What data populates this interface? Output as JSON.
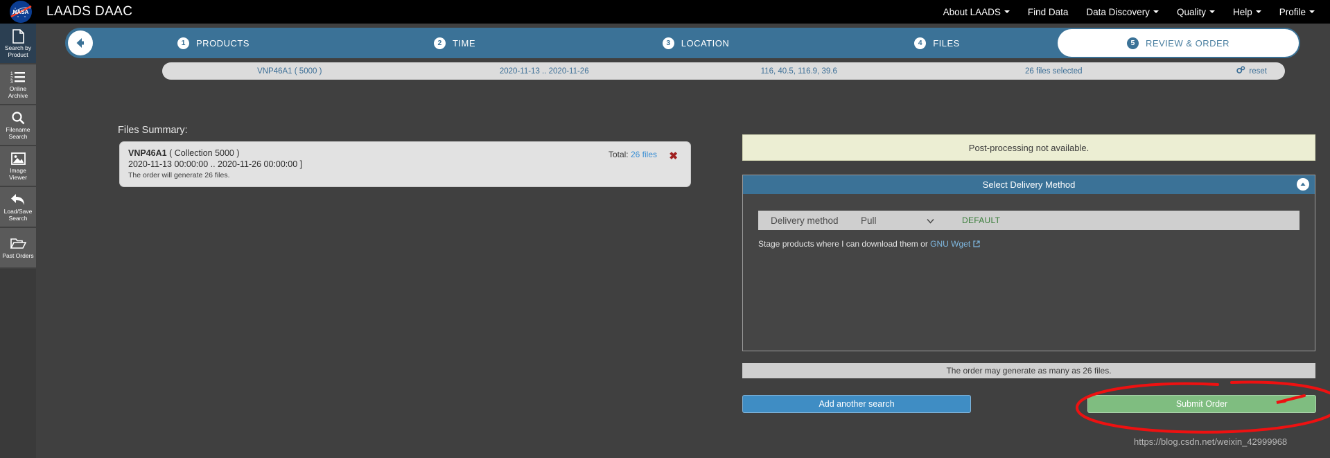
{
  "header": {
    "brand": "LAADS DAAC",
    "logo_icon": "nasa-meatball-logo",
    "nav": [
      {
        "label": "About LAADS",
        "has_caret": true
      },
      {
        "label": "Find Data",
        "has_caret": false
      },
      {
        "label": "Data Discovery",
        "has_caret": true
      },
      {
        "label": "Quality",
        "has_caret": true
      },
      {
        "label": "Help",
        "has_caret": true
      },
      {
        "label": "Profile",
        "has_caret": true
      }
    ]
  },
  "sidebar": {
    "items": [
      {
        "label": "Search by\nProduct",
        "icon": "document-icon",
        "active": true
      },
      {
        "label": "Online\nArchive",
        "icon": "list-numbered-icon",
        "active": false
      },
      {
        "label": "Filename\nSearch",
        "icon": "search-icon",
        "active": false
      },
      {
        "label": "Image\nViewer",
        "icon": "image-icon",
        "active": false
      },
      {
        "label": "Load/Save\nSearch",
        "icon": "arrow-back-icon",
        "active": false
      },
      {
        "label": "Past Orders",
        "icon": "folder-icon",
        "active": false
      }
    ]
  },
  "wizard": {
    "back_icon": "arrow-left-circle-icon",
    "steps": [
      {
        "num": "1",
        "label": "PRODUCTS",
        "current": false
      },
      {
        "num": "2",
        "label": "TIME",
        "current": false
      },
      {
        "num": "3",
        "label": "LOCATION",
        "current": false
      },
      {
        "num": "4",
        "label": "FILES",
        "current": false
      },
      {
        "num": "5",
        "label": "REVIEW & ORDER",
        "current": true
      }
    ]
  },
  "summary_strip": {
    "product": "VNP46A1 ( 5000 )",
    "time": "2020-11-13 .. 2020-11-26",
    "location": "116, 40.5, 116.9, 39.6",
    "files": "26 files selected",
    "reset_label": "reset",
    "reset_icon": "gears-icon"
  },
  "files_summary": {
    "title": "Files Summary:",
    "product_name": "VNP46A1",
    "collection": "( Collection 5000 )",
    "date_range": "2020-11-13 00:00:00 .. 2020-11-26 00:00:00 ]",
    "note": "The order will generate 26 files.",
    "total_label": "Total:",
    "total_value": "26 files",
    "remove_icon": "x-remove-icon"
  },
  "right_panel": {
    "notice": "Post-processing not available.",
    "panel_title": "Select Delivery Method",
    "collapse_icon": "chevron-up-circle-icon",
    "delivery_label": "Delivery method",
    "delivery_value": "Pull",
    "delivery_options": [
      "Pull"
    ],
    "default_badge": "DEFAULT",
    "note_prefix": "Stage products where I can download them or ",
    "note_link": "GNU Wget",
    "external_link_icon": "external-link-icon",
    "generate_bar": "The order may generate as many as 26 files.",
    "add_search_button": "Add another search",
    "submit_button": "Submit Order"
  },
  "watermark": "https://blog.csdn.net/weixin_42999968",
  "colors": {
    "accent_blue": "#3b7297",
    "button_blue": "#3f8dc4",
    "submit_green": "#7fbd80",
    "notice_bg": "#eceed3",
    "annotation_red": "#ee1111",
    "default_green": "#3a7d3a",
    "page_bg": "#404040"
  }
}
